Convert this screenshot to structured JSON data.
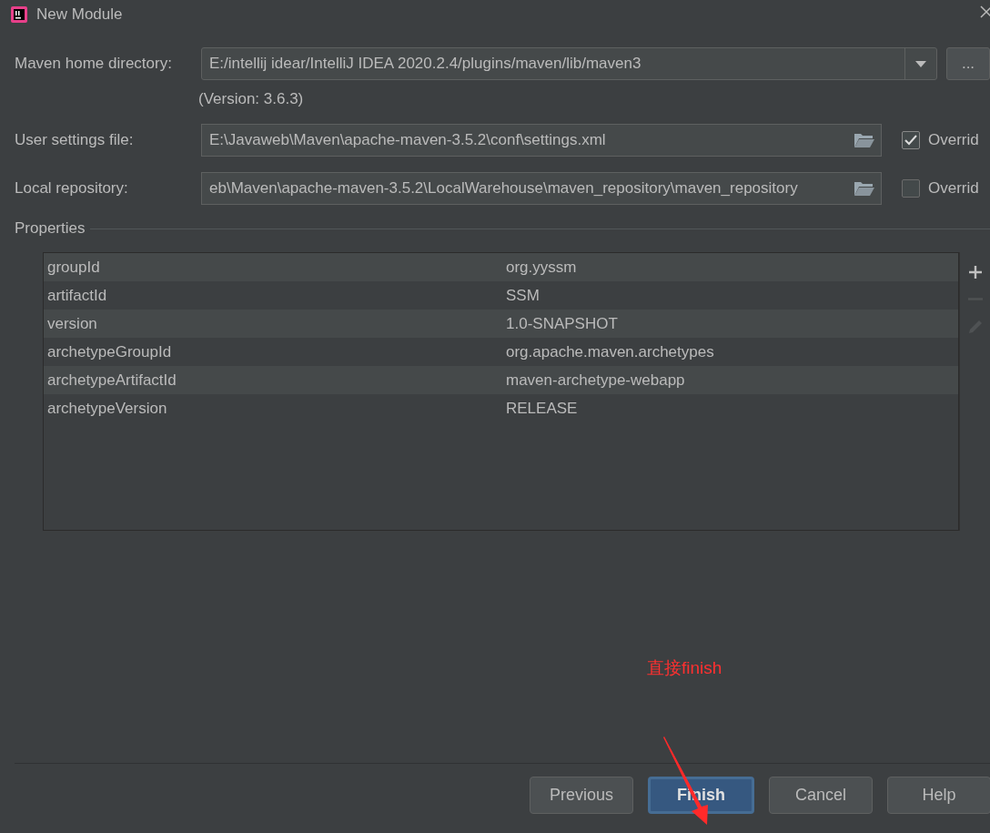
{
  "window": {
    "title": "New Module"
  },
  "maven_home": {
    "label": "Maven home directory:",
    "value": "E:/intellij idear/IntelliJ IDEA 2020.2.4/plugins/maven/lib/maven3",
    "browse": "..."
  },
  "version_note": "(Version: 3.6.3)",
  "settings_fields": [
    {
      "label": "User settings file:",
      "value": "E:\\Javaweb\\Maven\\apache-maven-3.5.2\\conf\\settings.xml",
      "override": {
        "label": "Overrid",
        "checked": true
      }
    },
    {
      "label": "Local repository:",
      "value": "eb\\Maven\\apache-maven-3.5.2\\LocalWarehouse\\maven_repository\\maven_repository",
      "override": {
        "label": "Overrid",
        "checked": false
      }
    }
  ],
  "properties": {
    "title": "Properties",
    "rows": [
      {
        "key": "groupId",
        "value": "org.yyssm"
      },
      {
        "key": "artifactId",
        "value": "SSM"
      },
      {
        "key": "version",
        "value": "1.0-SNAPSHOT"
      },
      {
        "key": "archetypeGroupId",
        "value": "org.apache.maven.archetypes"
      },
      {
        "key": "archetypeArtifactId",
        "value": "maven-archetype-webapp"
      },
      {
        "key": "archetypeVersion",
        "value": "RELEASE"
      }
    ],
    "tools": [
      {
        "kind": "add",
        "disabled": false
      },
      {
        "kind": "remove",
        "disabled": true
      },
      {
        "kind": "edit",
        "disabled": true
      }
    ]
  },
  "annotation": {
    "text": "直接finish"
  },
  "buttons": [
    {
      "label": "Previous",
      "default": false
    },
    {
      "label": "Finish",
      "default": true
    },
    {
      "label": "Cancel",
      "default": false
    },
    {
      "label": "Help",
      "default": false
    }
  ]
}
